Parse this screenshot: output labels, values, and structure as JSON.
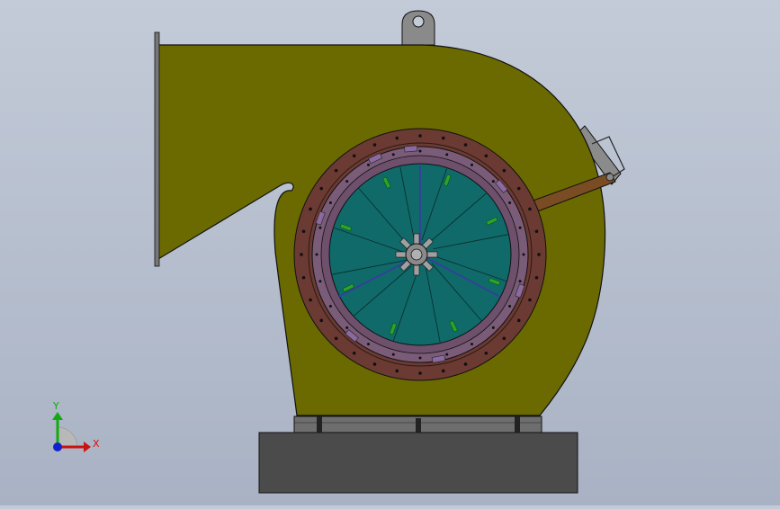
{
  "viewport": {
    "background_top": "#c3cbd8",
    "background_bottom": "#a9b2c4"
  },
  "fan": {
    "housing_color": "#6b6a00",
    "flange_color": "#6b3a32",
    "ring_color": "#7a5c78",
    "impeller_color": "#0f6a69",
    "base_color": "#4b4b4b",
    "blade_count": 12,
    "clip_color": "#2aa52a"
  },
  "triad": {
    "x_label": "X",
    "y_label": "Y",
    "x_color": "#cc1111",
    "y_color": "#11aa11",
    "z_color": "#1122cc"
  }
}
